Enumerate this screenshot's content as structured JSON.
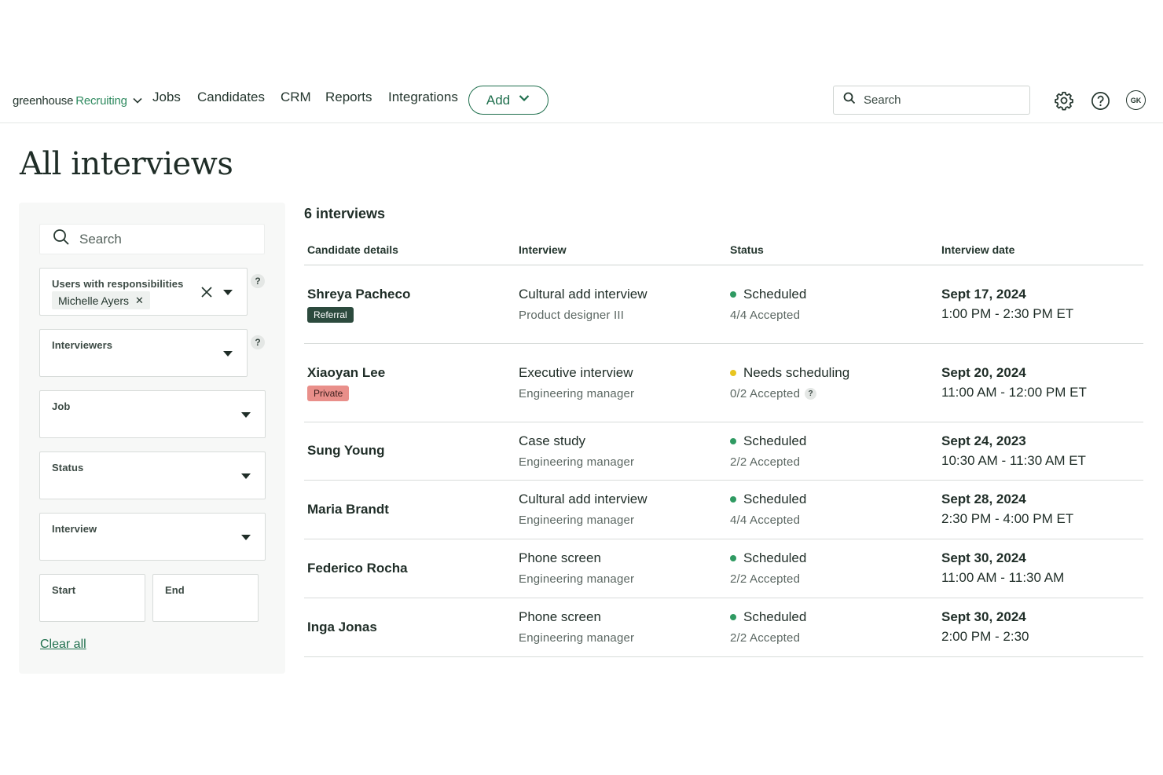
{
  "nav": {
    "brand_primary": "greenhouse",
    "brand_secondary": "Recruiting",
    "links": [
      "Jobs",
      "Candidates",
      "CRM",
      "Reports",
      "Integrations"
    ],
    "add_label": "Add",
    "search_placeholder": "Search",
    "avatar_initials": "GK",
    "icons": [
      "chevron-down-icon",
      "search-icon",
      "gear-icon",
      "help-icon"
    ]
  },
  "page": {
    "title": "All interviews"
  },
  "filters": {
    "search_placeholder": "Search",
    "users_label": "Users with responsibilities",
    "users_chip": "Michelle Ayers",
    "interviewers_label": "Interviewers",
    "job_label": "Job",
    "status_label": "Status",
    "interview_label": "Interview",
    "start_label": "Start",
    "end_label": "End",
    "help_mark": "?",
    "clear_all": "Clear all"
  },
  "table": {
    "count": "6 interviews",
    "headers": [
      "Candidate details",
      "Interview",
      "Status",
      "Interview date"
    ],
    "status_colors": {
      "scheduled": "#2f9a62",
      "needs": "#e8c520"
    },
    "rows": [
      {
        "candidate": "Shreya Pacheco",
        "tag": "Referral",
        "tag_type": "referral",
        "interview": "Cultural add interview",
        "role": "Product designer III",
        "status": "Scheduled",
        "status_type": "scheduled",
        "accepted": "4/4 Accepted",
        "date": "Sept 17, 2024",
        "time": "1:00 PM - 2:30 PM ET"
      },
      {
        "candidate": "Xiaoyan Lee",
        "tag": "Private",
        "tag_type": "private",
        "interview": "Executive interview",
        "role": "Engineering manager",
        "status": "Needs scheduling",
        "status_type": "needs",
        "accepted": "0/2 Accepted",
        "date": "Sept 20, 2024",
        "time": "11:00 AM - 12:00 PM ET"
      },
      {
        "candidate": "Sung Young",
        "tag": "",
        "tag_type": "",
        "interview": "Case study",
        "role": "Engineering manager",
        "status": "Scheduled",
        "status_type": "scheduled",
        "accepted": "2/2 Accepted",
        "date": "Sept 24, 2023",
        "time": "10:30 AM - 11:30 AM ET"
      },
      {
        "candidate": "Maria Brandt",
        "tag": "",
        "tag_type": "",
        "interview": "Cultural add interview",
        "role": "Engineering manager",
        "status": "Scheduled",
        "status_type": "scheduled",
        "accepted": "4/4 Accepted",
        "date": "Sept 28, 2024",
        "time": "2:30 PM - 4:00 PM ET"
      },
      {
        "candidate": "Federico Rocha",
        "tag": "",
        "tag_type": "",
        "interview": "Phone screen",
        "role": "Engineering manager",
        "status": "Scheduled",
        "status_type": "scheduled",
        "accepted": "2/2 Accepted",
        "date": "Sept 30, 2024",
        "time": "11:00 AM - 11:30 AM"
      },
      {
        "candidate": "Inga Jonas",
        "tag": "",
        "tag_type": "",
        "interview": "Phone screen",
        "role": "Engineering manager",
        "status": "Scheduled",
        "status_type": "scheduled",
        "accepted": "2/2 Accepted",
        "date": "Sept 30, 2024",
        "time": "2:00 PM - 2:30"
      }
    ]
  }
}
